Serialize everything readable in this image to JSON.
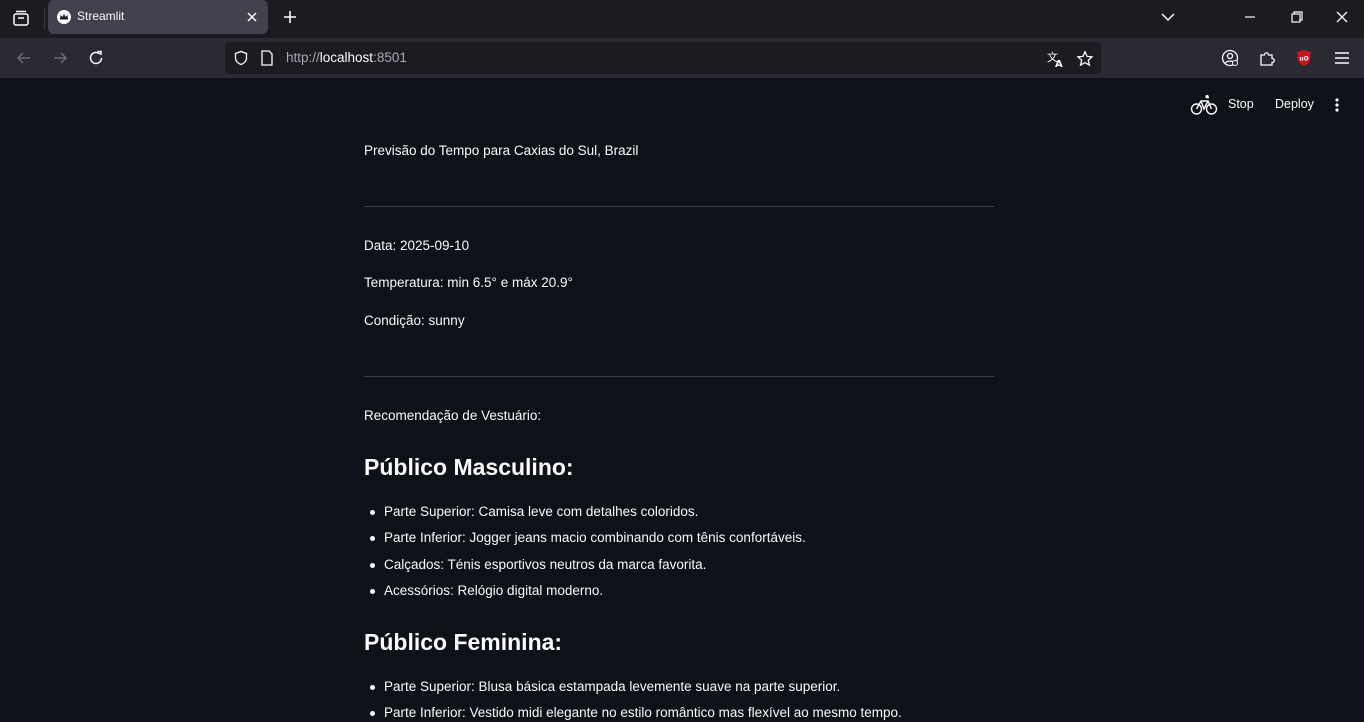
{
  "browser": {
    "tab_title": "Streamlit",
    "url_scheme": "http://",
    "url_host": "localhost",
    "url_port": ":8501"
  },
  "streamlit_header": {
    "stop_label": "Stop",
    "deploy_label": "Deploy"
  },
  "content": {
    "title_line": "Previsão do Tempo para Caxias do Sul, Brazil",
    "date_line": "Data: 2025-09-10",
    "temperature_line": "Temperatura: min 6.5° e máx 20.9°",
    "condition_line": "Condição: sunny",
    "recommendation_intro": "Recomendação de Vestuário:",
    "male_heading": "Público Masculino:",
    "male_items": [
      "Parte Superior: Camisa leve com detalhes coloridos.",
      "Parte Inferior: Jogger jeans macio combinando com tênis confortáveis.",
      "Calçados: Ténis esportivos neutros da marca favorita.",
      "Acessórios: Relógio digital moderno."
    ],
    "female_heading": "Público Feminina:",
    "female_items": [
      "Parte Superior: Blusa básica estampada levemente suave na parte superior.",
      "Parte Inferior: Vestido midi elegante no estilo romântico mas flexível ao mesmo tempo."
    ]
  },
  "icons": {
    "tab_list": "tab-list-icon",
    "favicon": "streamlit-crown-icon",
    "close": "close-icon",
    "new_tab": "plus-icon",
    "minimize": "minimize-icon",
    "restore": "restore-icon",
    "window_close": "window-close-icon",
    "back": "back-arrow-icon",
    "forward": "forward-arrow-icon",
    "reload": "reload-icon",
    "shield": "shield-icon",
    "page": "page-icon",
    "translate": "translate-icon",
    "bookmark": "star-icon",
    "account": "account-icon",
    "extensions": "puzzle-icon",
    "ublock": "ublock-icon",
    "app_menu": "hamburger-icon",
    "running": "bicycle-icon",
    "main_menu": "kebab-icon"
  },
  "colors": {
    "app_background": "#0e1117",
    "browser_tabbar": "#1c1b22",
    "browser_navbar": "#2b2a33",
    "text": "#fafafa",
    "divider": "#3c3f47",
    "ublock_red": "#c5161d"
  }
}
